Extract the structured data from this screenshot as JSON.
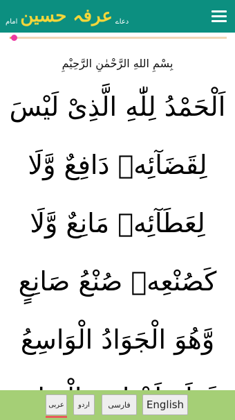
{
  "header": {
    "logo_main": "عرفہ حسین",
    "logo_prefix": "دعاے",
    "logo_sub": "امام",
    "menu_icon": "hamburger-menu-icon",
    "bar_color": "#0c8f80"
  },
  "audio": {
    "progress": 0.02,
    "knob_color": "#ec3aa2",
    "track_color": "#f1d7b7"
  },
  "text": {
    "bismillah": "بِسْمِ اللهِ الرَّحْمٰنِ الرَّحِيْمِ",
    "lines": [
      "اَلْحَمْدُ لِلّٰهِ الَّذِىْ لَيْسَ",
      "لِقَضَآئِهٖ دَافِعٌ وَّلَا",
      "لِعَطَآئِهٖ مَانِعٌ وَّلَا",
      "كَصُنْعِهٖ صُنْعُ صَانِعٍ",
      "وَّهُوَ الْجَوَادُ الْوَاسِعُ",
      "فَطَرَ اَجْنَاسَ الْبَدَائِعِ"
    ]
  },
  "languages": {
    "arabic": "عربی",
    "urdu": "اردو",
    "farsi": "فارسی",
    "english": "English",
    "bar_color": "#a5cf76",
    "selected_underline": "#e85a5a"
  }
}
